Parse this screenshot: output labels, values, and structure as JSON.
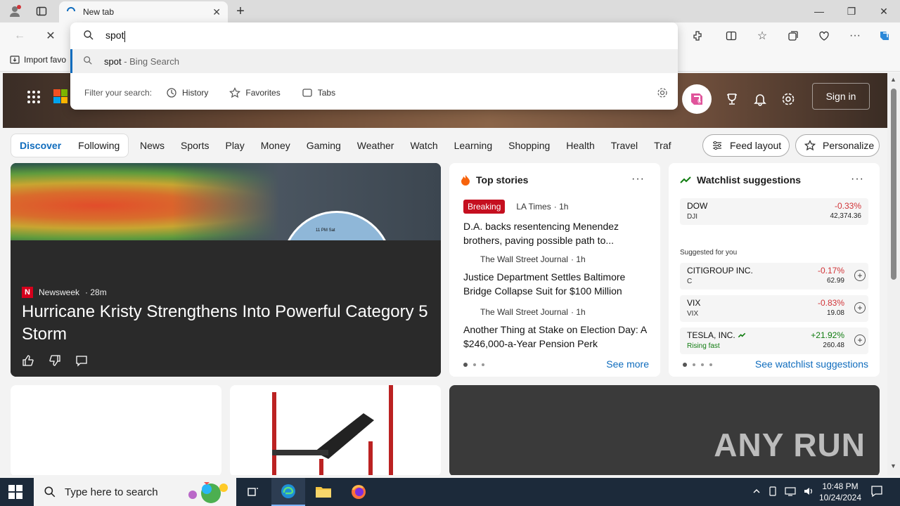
{
  "browser": {
    "tab_title": "New tab",
    "favorites_item": "Import favo",
    "address_query": "spot",
    "suggestion_query": "spot",
    "suggestion_source": " - Bing Search",
    "filter_label": "Filter your search:",
    "filters": [
      "History",
      "Favorites",
      "Tabs"
    ]
  },
  "header": {
    "sign_in": "Sign in",
    "copilot_badge": "6"
  },
  "nav": {
    "pill_tabs": [
      "Discover",
      "Following"
    ],
    "categories": [
      "News",
      "Sports",
      "Play",
      "Money",
      "Gaming",
      "Weather",
      "Watch",
      "Learning",
      "Shopping",
      "Health",
      "Travel",
      "Traf"
    ],
    "feed_layout": "Feed layout",
    "personalize": "Personalize"
  },
  "main_story": {
    "source": "Newsweek",
    "source_logo_letter": "N",
    "age": "· 28m",
    "headline": "Hurricane Kristy Strengthens Into Powerful Category 5 Storm",
    "map_label": "11 PM Sat"
  },
  "top_stories": {
    "title": "Top stories",
    "more": "···",
    "stories": [
      {
        "badge": "Breaking",
        "source": "LA Times",
        "age": "· 1h",
        "headline": "D.A. backs resentencing Menendez brothers, paving possible path to..."
      },
      {
        "source": "The Wall Street Journal",
        "age": "· 1h",
        "headline": "Justice Department Settles Baltimore Bridge Collapse Suit for $100 Million"
      },
      {
        "source": "The Wall Street Journal",
        "age": "· 1h",
        "headline": "Another Thing at Stake on Election Day: A $246,000-a-Year Pension Perk"
      }
    ],
    "see_more": "See more"
  },
  "watchlist": {
    "title": "Watchlist suggestions",
    "more": "···",
    "suggested_label": "Suggested for you",
    "stocks": [
      {
        "name": "DOW",
        "ticker": "DJI",
        "change": "-0.33%",
        "price": "42,374.36"
      },
      {
        "name": "CITIGROUP INC.",
        "ticker": "C",
        "change": "-0.17%",
        "price": "62.99"
      },
      {
        "name": "VIX",
        "ticker": "VIX",
        "change": "-0.83%",
        "price": "19.08"
      },
      {
        "name": "TESLA, INC.",
        "ticker": "Rising fast",
        "change": "+21.92%",
        "price": "260.48"
      }
    ],
    "see_link": "See watchlist suggestions"
  },
  "watermark": "ANY RUN",
  "taskbar": {
    "search_placeholder": "Type here to search",
    "time": "10:48 PM",
    "date": "10/24/2024"
  },
  "colors": {
    "accent": "#0f6cbd",
    "breaking": "#c50f1f",
    "negative": "#d13438",
    "positive": "#107c10"
  }
}
